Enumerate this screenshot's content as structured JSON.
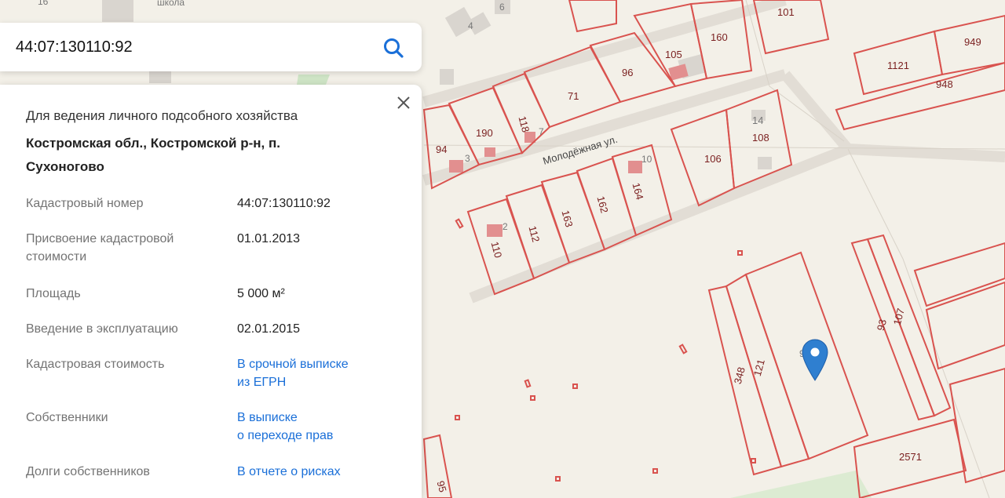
{
  "search": {
    "value": "44:07:130110:92"
  },
  "panel": {
    "purpose": "Для ведения личного подсобного хозяйства",
    "address": "Костромская обл., Костромской р-н, п. Сухоногово",
    "rows": [
      {
        "key": "Кадастровый номер",
        "value": "44:07:130110:92"
      },
      {
        "key": "Присвоение кадастровой стоимости",
        "value": "01.01.2013"
      },
      {
        "key": "Площадь",
        "value": "5 000 м²"
      },
      {
        "key": "Введение в эксплуатацию",
        "value": "02.01.2015"
      },
      {
        "key": "Кадастровая стоимость",
        "link1": "В срочной выписке",
        "link2": "из ЕГРН"
      },
      {
        "key": "Собственники",
        "link1": "В выписке",
        "link2": "о переходе прав"
      },
      {
        "key": "Долги собственников",
        "link1": "В отчете о рисках"
      }
    ]
  },
  "map": {
    "street": "Молодёжная ул.",
    "school": "школа",
    "lot_labels": [
      "16",
      "6",
      "4",
      "101",
      "160",
      "949",
      "105",
      "1121",
      "96",
      "948",
      "71",
      "118",
      "7",
      "190",
      "94",
      "3",
      "14",
      "108",
      "106",
      "10",
      "164",
      "162",
      "163",
      "112",
      "2",
      "110",
      "9",
      "121",
      "348",
      "93",
      "107",
      "2571",
      "95"
    ]
  },
  "colors": {
    "lot_line": "#d9534f",
    "link": "#1a6fd8",
    "marker": "#2f7fd0"
  }
}
